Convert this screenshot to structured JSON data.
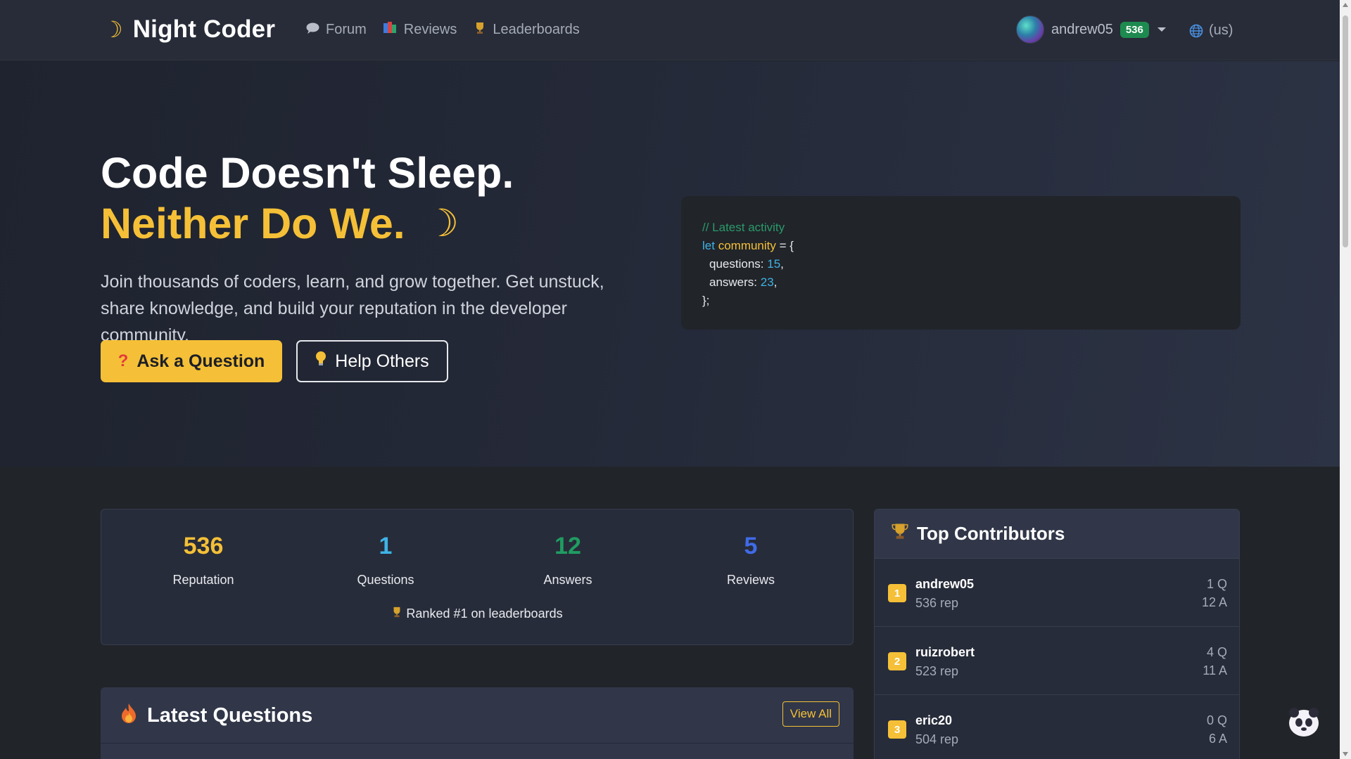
{
  "nav": {
    "brand": "Night Coder",
    "brand_icon": "crescent-moon-icon",
    "links": [
      {
        "label": "Forum",
        "icon": "speech-bubble-icon"
      },
      {
        "label": "Reviews",
        "icon": "books-icon"
      },
      {
        "label": "Leaderboards",
        "icon": "trophy-icon"
      }
    ],
    "user": {
      "name": "andrew05",
      "reputation": "536"
    },
    "language": "(us)"
  },
  "hero": {
    "title_line1": "Code Doesn't Sleep.",
    "title_line2": "Neither Do We.",
    "description": "Join thousands of coders, learn, and grow together. Get unstuck, share knowledge, and build your reputation in the developer community.",
    "ask_button": "Ask a Question",
    "help_button": "Help Others",
    "code": {
      "comment": "// Latest activity",
      "keyword": "let",
      "variable": "community",
      "assign": " = {",
      "line_questions_key": "questions: ",
      "line_questions_val": "15",
      "line_answers_key": "answers: ",
      "line_answers_val": "23",
      "close": "};"
    }
  },
  "stats": {
    "items": [
      {
        "value": "536",
        "label": "Reputation",
        "color": "#f5c037"
      },
      {
        "value": "1",
        "label": "Questions",
        "color": "#3fb3e6"
      },
      {
        "value": "12",
        "label": "Answers",
        "color": "#1f9d61"
      },
      {
        "value": "5",
        "label": "Reviews",
        "color": "#3f6be8"
      }
    ],
    "ranked_text": "Ranked #1 on leaderboards"
  },
  "latest_questions": {
    "title": "Latest Questions",
    "view_all": "View All"
  },
  "contributors": {
    "title": "Top Contributors",
    "rows": [
      {
        "rank": "1",
        "name": "andrew05",
        "rep": "536 rep",
        "q": "1 Q",
        "a": "12 A"
      },
      {
        "rank": "2",
        "name": "ruizrobert",
        "rep": "523 rep",
        "q": "4 Q",
        "a": "11 A"
      },
      {
        "rank": "3",
        "name": "eric20",
        "rep": "504 rep",
        "q": "0 Q",
        "a": "6 A"
      }
    ]
  },
  "colors": {
    "accent": "#f5c037",
    "background": "#212429",
    "badge_green": "#1d8a4f"
  }
}
